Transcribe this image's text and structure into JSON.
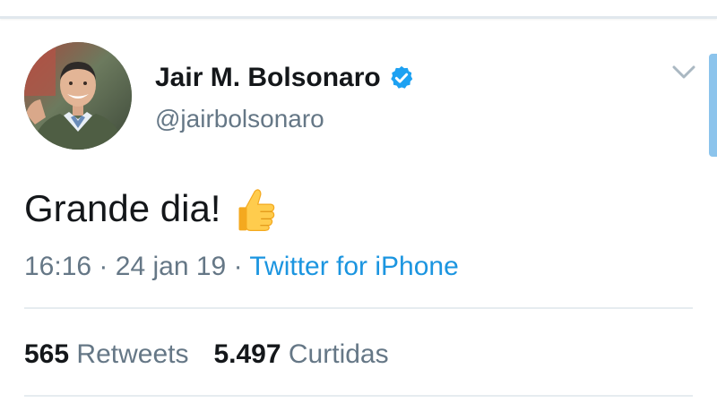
{
  "tweet": {
    "author": {
      "display_name": "Jair M. Bolsonaro",
      "handle": "@jairbolsonaro",
      "verified": true,
      "avatar": "profile-photo"
    },
    "text": "Grande dia!",
    "emoji": "thumbs-up-icon",
    "time": "16:16",
    "separator": "·",
    "date": "24 jan 19",
    "source": "Twitter for iPhone",
    "stats": {
      "retweets_count": "565",
      "retweets_label": "Retweets",
      "likes_count": "5.497",
      "likes_label": "Curtidas"
    }
  },
  "colors": {
    "link": "#1b95e0",
    "secondary_text": "#657786",
    "verified": "#1da1f2",
    "divider": "#e6ecf0"
  }
}
